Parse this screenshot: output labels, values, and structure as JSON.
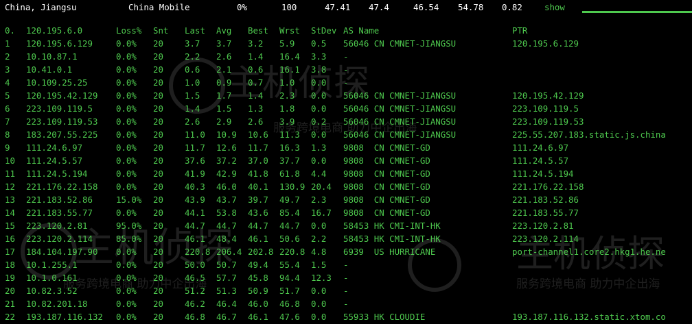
{
  "summary": {
    "location": "China, Jiangsu",
    "isp": "China Mobile",
    "loss": "0%",
    "sent": "100",
    "last": "47.41",
    "avg": "47.4",
    "best": "46.54",
    "worst": "54.78",
    "stdev": "0.82",
    "show_label": "show"
  },
  "header": {
    "hop": "0.",
    "host": "120.195.6.0",
    "loss": "Loss%",
    "snt": "Snt",
    "last": "Last",
    "avg": "Avg",
    "best": "Best",
    "wrst": "Wrst",
    "stdev": "StDev",
    "as": "AS Name",
    "ptr": "PTR"
  },
  "rows": [
    {
      "hop": "1",
      "host": "120.195.6.129",
      "loss": "0.0%",
      "snt": "20",
      "last": "3.7",
      "avg": "3.7",
      "best": "3.2",
      "wrst": "5.9",
      "stdev": "0.5",
      "as": "56046 CN CMNET-JIANGSU",
      "ptr": "120.195.6.129"
    },
    {
      "hop": "2",
      "host": "10.10.87.1",
      "loss": "0.0%",
      "snt": "20",
      "last": "2.2",
      "avg": "2.6",
      "best": "1.4",
      "wrst": "16.4",
      "stdev": "3.3",
      "as": "-",
      "ptr": ""
    },
    {
      "hop": "3",
      "host": "10.41.0.1",
      "loss": "0.0%",
      "snt": "20",
      "last": "0.6",
      "avg": "2.1",
      "best": "0.6",
      "wrst": "16.1",
      "stdev": "3.8",
      "as": "-",
      "ptr": ""
    },
    {
      "hop": "4",
      "host": "10.109.25.25",
      "loss": "0.0%",
      "snt": "20",
      "last": "1.0",
      "avg": "0.9",
      "best": "0.7",
      "wrst": "1.0",
      "stdev": "0.0",
      "as": "-",
      "ptr": ""
    },
    {
      "hop": "5",
      "host": "120.195.42.129",
      "loss": "0.0%",
      "snt": "20",
      "last": "1.5",
      "avg": "1.7",
      "best": "1.4",
      "wrst": "2.3",
      "stdev": "0.0",
      "as": "56046 CN CMNET-JIANGSU",
      "ptr": "120.195.42.129"
    },
    {
      "hop": "6",
      "host": "223.109.119.5",
      "loss": "0.0%",
      "snt": "20",
      "last": "1.4",
      "avg": "1.5",
      "best": "1.3",
      "wrst": "1.8",
      "stdev": "0.0",
      "as": "56046 CN CMNET-JIANGSU",
      "ptr": "223.109.119.5"
    },
    {
      "hop": "7",
      "host": "223.109.119.53",
      "loss": "0.0%",
      "snt": "20",
      "last": "2.6",
      "avg": "2.9",
      "best": "2.6",
      "wrst": "3.9",
      "stdev": "0.2",
      "as": "56046 CN CMNET-JIANGSU",
      "ptr": "223.109.119.53"
    },
    {
      "hop": "8",
      "host": "183.207.55.225",
      "loss": "0.0%",
      "snt": "20",
      "last": "11.0",
      "avg": "10.9",
      "best": "10.6",
      "wrst": "11.3",
      "stdev": "0.0",
      "as": "56046 CN CMNET-JIANGSU",
      "ptr": "225.55.207.183.static.js.china"
    },
    {
      "hop": "9",
      "host": "111.24.6.97",
      "loss": "0.0%",
      "snt": "20",
      "last": "11.7",
      "avg": "12.6",
      "best": "11.7",
      "wrst": "16.3",
      "stdev": "1.3",
      "as": "9808  CN CMNET-GD",
      "ptr": "111.24.6.97"
    },
    {
      "hop": "10",
      "host": "111.24.5.57",
      "loss": "0.0%",
      "snt": "20",
      "last": "37.6",
      "avg": "37.2",
      "best": "37.0",
      "wrst": "37.7",
      "stdev": "0.0",
      "as": "9808  CN CMNET-GD",
      "ptr": "111.24.5.57"
    },
    {
      "hop": "11",
      "host": "111.24.5.194",
      "loss": "0.0%",
      "snt": "20",
      "last": "41.9",
      "avg": "42.9",
      "best": "41.8",
      "wrst": "61.8",
      "stdev": "4.4",
      "as": "9808  CN CMNET-GD",
      "ptr": "111.24.5.194"
    },
    {
      "hop": "12",
      "host": "221.176.22.158",
      "loss": "0.0%",
      "snt": "20",
      "last": "40.3",
      "avg": "46.0",
      "best": "40.1",
      "wrst": "130.9",
      "stdev": "20.4",
      "as": "9808  CN CMNET-GD",
      "ptr": "221.176.22.158"
    },
    {
      "hop": "13",
      "host": "221.183.52.86",
      "loss": "15.0%",
      "snt": "20",
      "last": "43.9",
      "avg": "43.7",
      "best": "39.7",
      "wrst": "49.7",
      "stdev": "2.3",
      "as": "9808  CN CMNET-GD",
      "ptr": "221.183.52.86"
    },
    {
      "hop": "14",
      "host": "221.183.55.77",
      "loss": "0.0%",
      "snt": "20",
      "last": "44.1",
      "avg": "53.8",
      "best": "43.6",
      "wrst": "85.4",
      "stdev": "16.7",
      "as": "9808  CN CMNET-GD",
      "ptr": "221.183.55.77"
    },
    {
      "hop": "15",
      "host": "223.120.2.81",
      "loss": "95.0%",
      "snt": "20",
      "last": "44.7",
      "avg": "44.7",
      "best": "44.7",
      "wrst": "44.7",
      "stdev": "0.0",
      "as": "58453 HK CMI-INT-HK",
      "ptr": "223.120.2.81"
    },
    {
      "hop": "16",
      "host": "223.120.2.114",
      "loss": "85.0%",
      "snt": "20",
      "last": "46.1",
      "avg": "48.4",
      "best": "46.1",
      "wrst": "50.6",
      "stdev": "2.2",
      "as": "58453 HK CMI-INT-HK",
      "ptr": "223.120.2.114"
    },
    {
      "hop": "17",
      "host": "184.104.197.90",
      "loss": "0.0%",
      "snt": "20",
      "last": "220.8",
      "avg": "206.4",
      "best": "202.8",
      "wrst": "220.8",
      "stdev": "4.8",
      "as": "6939  US HURRICANE",
      "ptr": "port-channel1.core2.hkg1.he.ne"
    },
    {
      "hop": "18",
      "host": "10.1.255.1",
      "loss": "0.0%",
      "snt": "20",
      "last": "50.0",
      "avg": "50.7",
      "best": "49.4",
      "wrst": "55.4",
      "stdev": "1.5",
      "as": "-",
      "ptr": ""
    },
    {
      "hop": "19",
      "host": "10.1.0.161",
      "loss": "0.0%",
      "snt": "20",
      "last": "46.5",
      "avg": "57.7",
      "best": "45.8",
      "wrst": "94.4",
      "stdev": "12.3",
      "as": "-",
      "ptr": ""
    },
    {
      "hop": "20",
      "host": "10.82.3.52",
      "loss": "0.0%",
      "snt": "20",
      "last": "51.2",
      "avg": "51.3",
      "best": "50.9",
      "wrst": "51.7",
      "stdev": "0.0",
      "as": "-",
      "ptr": ""
    },
    {
      "hop": "21",
      "host": "10.82.201.18",
      "loss": "0.0%",
      "snt": "20",
      "last": "46.2",
      "avg": "46.4",
      "best": "46.0",
      "wrst": "46.8",
      "stdev": "0.0",
      "as": "-",
      "ptr": ""
    },
    {
      "hop": "22",
      "host": "193.187.116.132",
      "loss": "0.0%",
      "snt": "20",
      "last": "46.8",
      "avg": "46.7",
      "best": "46.1",
      "wrst": "47.6",
      "stdev": "0.0",
      "as": "55933 HK CLOUDIE",
      "ptr": "193.187.116.132.static.xtom.co"
    }
  ],
  "watermark": {
    "brand": "主机侦探",
    "tagline": "服务跨境电商 助力中企出海"
  },
  "colors": {
    "background": "#000000",
    "text": "#4ec94e",
    "summary_text": "#ffffff"
  }
}
